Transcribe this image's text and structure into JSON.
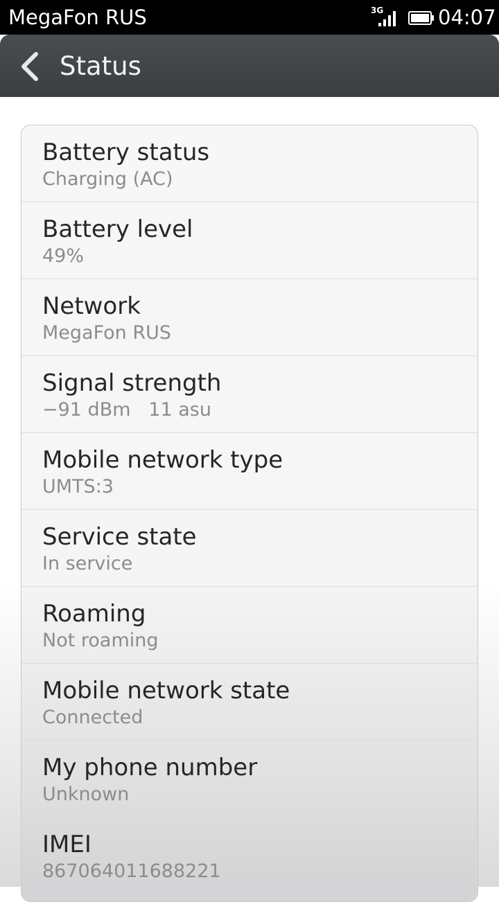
{
  "status_bar": {
    "carrier": "MegaFon RUS",
    "network_type": "3G",
    "time": "04:07",
    "icons": [
      "signal-icon",
      "battery-icon"
    ]
  },
  "action_bar": {
    "back_icon": "back-arrow-icon",
    "title": "Status"
  },
  "items": [
    {
      "title": "Battery status",
      "value": "Charging (AC)"
    },
    {
      "title": "Battery level",
      "value": "49%"
    },
    {
      "title": "Network",
      "value": "MegaFon RUS"
    },
    {
      "title": "Signal strength",
      "value": "−91 dBm   11 asu"
    },
    {
      "title": "Mobile network type",
      "value": "UMTS:3"
    },
    {
      "title": "Service state",
      "value": "In service"
    },
    {
      "title": "Roaming",
      "value": "Not roaming"
    },
    {
      "title": "Mobile network state",
      "value": "Connected"
    },
    {
      "title": "My phone number",
      "value": "Unknown"
    },
    {
      "title": "IMEI",
      "value": "867064011688221"
    }
  ]
}
